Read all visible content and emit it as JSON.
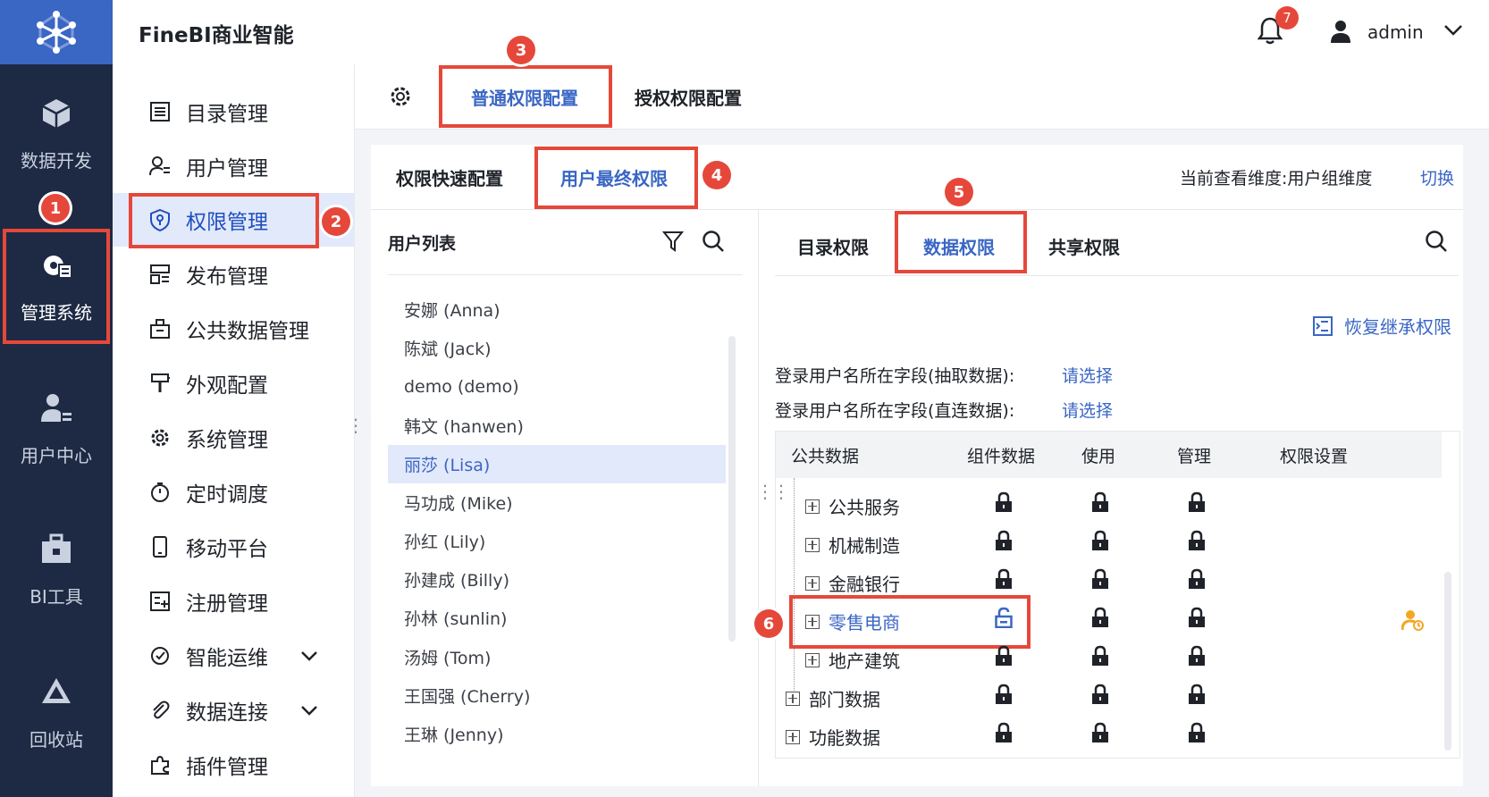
{
  "app": {
    "brand": "FineBI商业智能"
  },
  "header": {
    "notification_count": "7",
    "username": "admin"
  },
  "rail": [
    {
      "label": "数据开发",
      "icon": "cube-icon"
    },
    {
      "label": "管理系统",
      "icon": "gear-doc-icon"
    },
    {
      "label": "用户中心",
      "icon": "user-center-icon"
    },
    {
      "label": "BI工具",
      "icon": "toolbox-icon"
    },
    {
      "label": "回收站",
      "icon": "recycle-icon"
    }
  ],
  "submenu": [
    {
      "label": "目录管理"
    },
    {
      "label": "用户管理"
    },
    {
      "label": "权限管理"
    },
    {
      "label": "发布管理"
    },
    {
      "label": "公共数据管理"
    },
    {
      "label": "外观配置"
    },
    {
      "label": "系统管理"
    },
    {
      "label": "定时调度"
    },
    {
      "label": "移动平台"
    },
    {
      "label": "注册管理"
    },
    {
      "label": "智能运维"
    },
    {
      "label": "数据连接"
    },
    {
      "label": "插件管理"
    }
  ],
  "top_tabs": {
    "normal": "普通权限配置",
    "grant": "授权权限配置"
  },
  "sub_tabs": {
    "quick": "权限快速配置",
    "final": "用户最终权限"
  },
  "dimension": {
    "label": "当前查看维度:用户组维度",
    "switch": "切换"
  },
  "user_list": {
    "title": "用户列表",
    "users": [
      "安娜 (Anna)",
      "陈斌 (Jack)",
      "demo (demo)",
      "韩文 (hanwen)",
      "丽莎 (Lisa)",
      "马功成 (Mike)",
      "孙红 (Lily)",
      "孙建成 (Billy)",
      "孙林 (sunlin)",
      "汤姆 (Tom)",
      "王国强 (Cherry)",
      "王琳 (Jenny)"
    ]
  },
  "right_tabs": {
    "catalog": "目录权限",
    "data": "数据权限",
    "share": "共享权限"
  },
  "restore_label": "恢复继承权限",
  "fields": {
    "extract_label": "登录用户名所在字段(抽取数据):",
    "direct_label": "登录用户名所在字段(直连数据):",
    "choose": "请选择"
  },
  "grid": {
    "headers": [
      "公共数据",
      "组件数据",
      "使用",
      "管理",
      "权限设置"
    ],
    "rows": [
      {
        "label": "公共服务"
      },
      {
        "label": "机械制造"
      },
      {
        "label": "金融银行"
      },
      {
        "label": "零售电商"
      },
      {
        "label": "地产建筑"
      },
      {
        "label": "部门数据"
      },
      {
        "label": "功能数据"
      }
    ]
  },
  "badges": [
    "1",
    "2",
    "3",
    "4",
    "5",
    "6"
  ],
  "colors": {
    "accent": "#3a66c4",
    "annotation": "#e5483a",
    "rail_bg": "#1e2a44",
    "warn_icon": "#f5a623"
  }
}
